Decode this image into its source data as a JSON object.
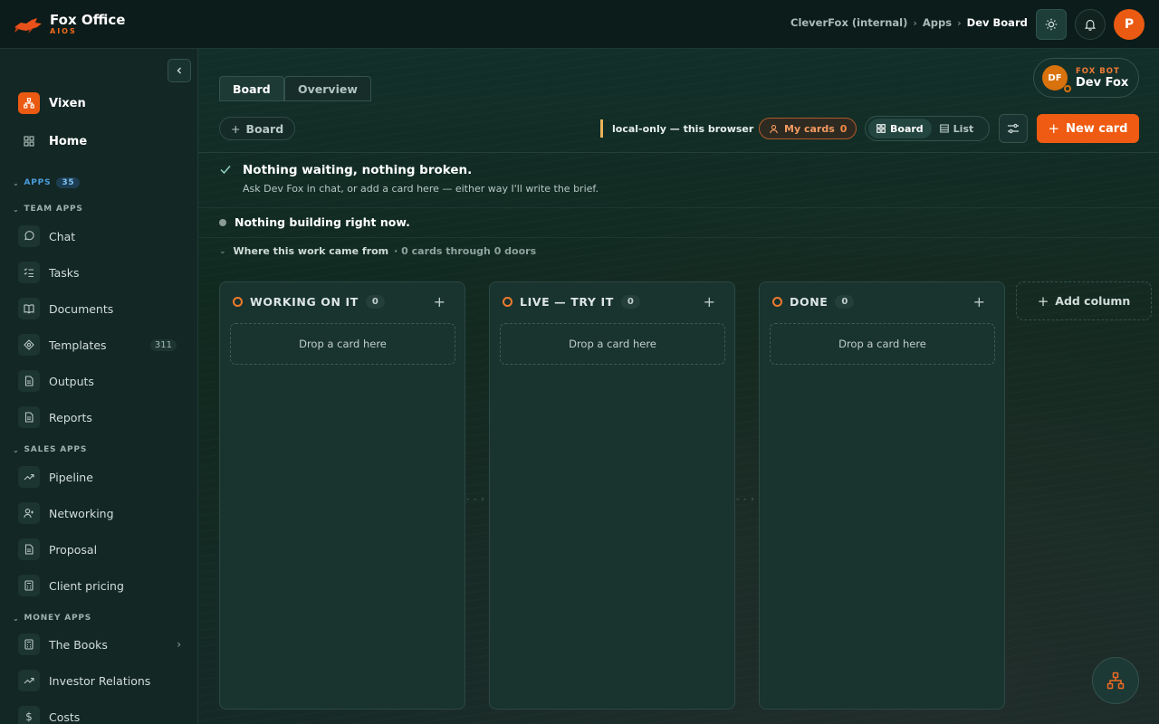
{
  "brand": {
    "name": "Fox Office",
    "sub": "AIOS"
  },
  "breadcrumb": {
    "org": "CleverFox (internal)",
    "section": "Apps",
    "current": "Dev Board",
    "separator": "›"
  },
  "user": {
    "initial": "P"
  },
  "sidebar": {
    "vixen": "Vixen",
    "home": "Home",
    "apps_label": "APPS",
    "apps_count": "35",
    "team_apps": {
      "label": "TEAM APPS",
      "items": [
        {
          "label": "Chat",
          "icon": "chat-icon"
        },
        {
          "label": "Tasks",
          "icon": "tasks-icon"
        },
        {
          "label": "Documents",
          "icon": "book-icon"
        },
        {
          "label": "Templates",
          "icon": "templates-icon",
          "count": "311"
        },
        {
          "label": "Outputs",
          "icon": "document-icon"
        },
        {
          "label": "Reports",
          "icon": "document-icon"
        }
      ]
    },
    "sales_apps": {
      "label": "SALES APPS",
      "items": [
        {
          "label": "Pipeline",
          "icon": "trend-icon"
        },
        {
          "label": "Networking",
          "icon": "user-plus-icon"
        },
        {
          "label": "Proposal",
          "icon": "document-icon"
        },
        {
          "label": "Client pricing",
          "icon": "calculator-icon"
        }
      ]
    },
    "money_apps": {
      "label": "MONEY APPS",
      "items": [
        {
          "label": "The Books",
          "icon": "calculator-icon"
        },
        {
          "label": "Investor Relations",
          "icon": "trend-icon"
        },
        {
          "label": "Costs",
          "icon": "dollar-icon"
        }
      ]
    }
  },
  "tabs": {
    "board": "Board",
    "overview": "Overview"
  },
  "toolbar": {
    "add_board": "Board",
    "local_note": "local-only — this browser",
    "my_cards": "My cards",
    "my_cards_count": "0",
    "view_board": "Board",
    "view_list": "List",
    "new_card": "New card"
  },
  "fox_bot": {
    "kicker": "FOX BOT",
    "name": "Dev Fox",
    "initials": "DF"
  },
  "status": {
    "title": "Nothing waiting, nothing broken.",
    "subtitle": "Ask Dev Fox in chat, or add a card here — either way I'll write the brief.",
    "building": "Nothing building right now.",
    "origin_label": "Where this work came from",
    "origin_meta": "· 0 cards through 0 doors"
  },
  "columns": [
    {
      "title": "WORKING ON IT",
      "count": "0",
      "drop": "Drop a card here"
    },
    {
      "title": "LIVE — TRY IT",
      "count": "0",
      "drop": "Drop a card here"
    },
    {
      "title": "DONE",
      "count": "0",
      "drop": "Drop a card here"
    }
  ],
  "add_column": "Add column",
  "colors": {
    "accent": "#ef5b12",
    "background": "#10231f",
    "sidebar": "#132724"
  }
}
